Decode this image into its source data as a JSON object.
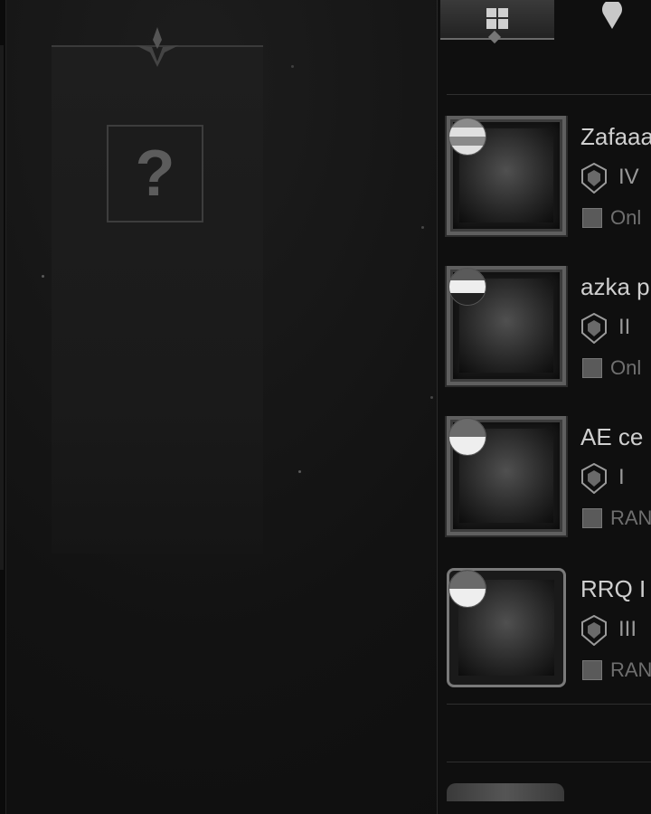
{
  "tabs": [
    {
      "icon": "grid-icon",
      "active": true
    },
    {
      "icon": "location-pin-icon",
      "active": false
    }
  ],
  "slot": {
    "mystery_symbol": "?"
  },
  "players": [
    {
      "name": "Zafaaa",
      "tier": "IV",
      "status": "Onl",
      "flag": "malaysia-flag-icon",
      "frame": "ornate"
    },
    {
      "name": "azka p",
      "tier": "II",
      "status": "Onl",
      "flag": "uae-flag-icon",
      "frame": "ornate"
    },
    {
      "name": "AE ce",
      "tier": "I",
      "status": "RAN",
      "flag": "indonesia-flag-icon",
      "frame": "ornate"
    },
    {
      "name": "RRQ I",
      "tier": "III",
      "status": "RAN",
      "flag": "indonesia-flag-icon",
      "frame": "plain"
    }
  ],
  "colors": {
    "background": "#111111",
    "panel": "#1e1e1e",
    "text": "#cfcfcf"
  }
}
